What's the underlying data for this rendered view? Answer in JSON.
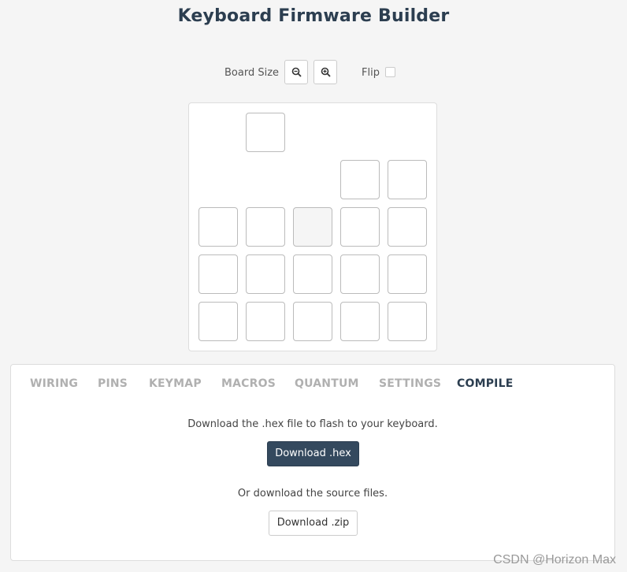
{
  "header": {
    "title": "Keyboard Firmware Builder"
  },
  "controls": {
    "board_size_label": "Board Size",
    "flip_label": "Flip",
    "flip_checked": false
  },
  "board": {
    "layout": "5 columns x 5 rows with gaps",
    "selected_key": "row 3, column 3"
  },
  "tabs": [
    {
      "label": "WIRING",
      "active": false
    },
    {
      "label": "PINS",
      "active": false
    },
    {
      "label": "KEYMAP",
      "active": false
    },
    {
      "label": "MACROS",
      "active": false
    },
    {
      "label": "QUANTUM",
      "active": false
    },
    {
      "label": "SETTINGS",
      "active": false
    },
    {
      "label": "COMPILE",
      "active": true
    }
  ],
  "compile": {
    "hex_message": "Download the .hex file to flash to your keyboard.",
    "hex_button": "Download .hex",
    "zip_message": "Or download the source files.",
    "zip_button": "Download .zip"
  },
  "watermark": "CSDN @Horizon Max",
  "colors": {
    "primary": "#34495e",
    "text": "#2c3e50",
    "inactive_tab": "#b0b0b0",
    "background": "#f5f5f5"
  }
}
